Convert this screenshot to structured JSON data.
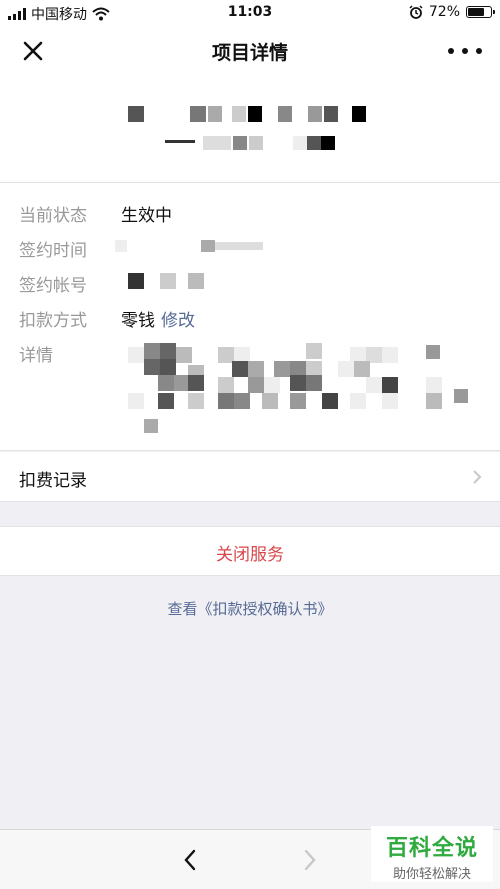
{
  "status_bar": {
    "carrier": "中国移动",
    "time": "11:03",
    "battery": "72%",
    "battery_level": 0.72
  },
  "nav": {
    "title": "项目详情"
  },
  "details": {
    "status_label": "当前状态",
    "status_value": "生效中",
    "sign_time_label": "签约时间",
    "account_label": "签约帐号",
    "payment_label": "扣款方式",
    "payment_value": "零钱",
    "payment_edit": "修改",
    "detail_label": "详情"
  },
  "records": {
    "label": "扣费记录"
  },
  "actions": {
    "close_service": "关闭服务",
    "agreement_link": "查看《扣款授权确认书》"
  },
  "watermark": {
    "title": "百科全说",
    "subtitle": "助你轻松解决"
  },
  "colors": {
    "link": "#576b95",
    "danger": "#d9464a",
    "watermark_green": "#2eaa3e"
  }
}
